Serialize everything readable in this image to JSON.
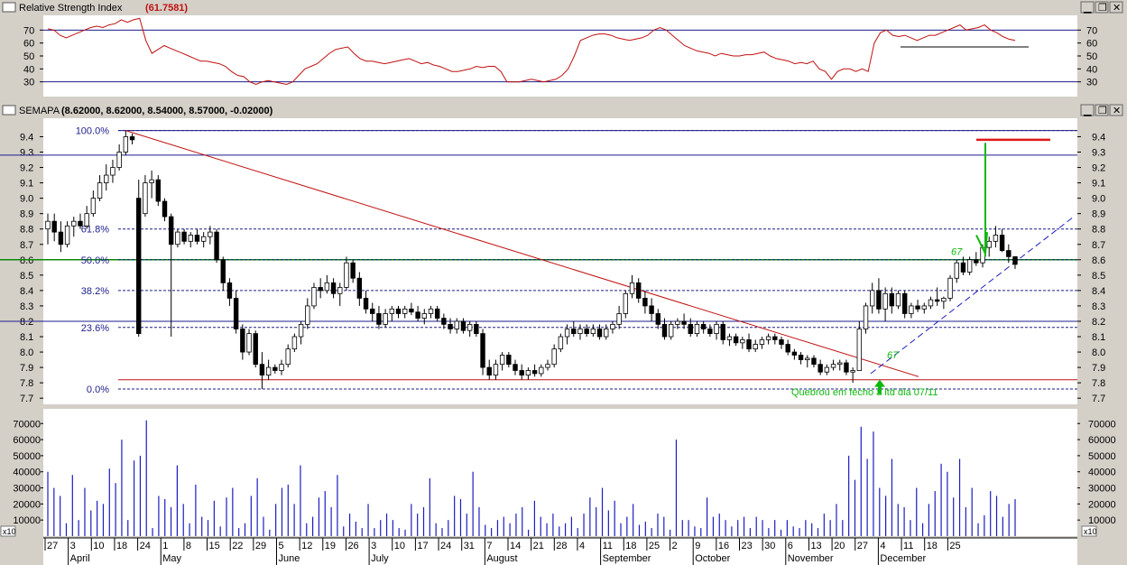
{
  "rsi_panel": {
    "title": "Relative Strength Index",
    "value": "(61.7581)",
    "ticks": [
      70,
      60,
      50,
      40,
      30
    ],
    "levels": [
      70,
      30
    ],
    "ylim": [
      20,
      80
    ],
    "values": [
      71,
      70,
      66,
      64,
      66,
      68,
      70,
      72,
      73,
      72,
      74,
      75,
      78,
      76,
      78,
      79,
      62,
      52,
      55,
      58,
      56,
      54,
      52,
      50,
      48,
      46,
      46,
      45,
      44,
      42,
      38,
      35,
      34,
      30,
      28,
      30,
      31,
      30,
      29,
      28,
      30,
      35,
      40,
      42,
      44,
      48,
      52,
      55,
      56,
      57,
      52,
      48,
      46,
      46,
      45,
      44,
      45,
      46,
      47,
      48,
      46,
      44,
      45,
      43,
      42,
      40,
      38,
      38,
      39,
      40,
      42,
      41,
      42,
      42,
      38,
      30,
      30,
      30,
      31,
      32,
      31,
      30,
      31,
      32,
      35,
      40,
      50,
      62,
      64,
      66,
      67,
      67,
      66,
      64,
      63,
      62,
      63,
      64,
      66,
      70,
      72,
      70,
      66,
      62,
      58,
      56,
      54,
      53,
      52,
      50,
      52,
      51,
      50,
      50,
      51,
      51,
      52,
      53,
      50,
      48,
      47,
      46,
      44,
      45,
      44,
      46,
      40,
      38,
      32,
      38,
      40,
      40,
      38,
      40,
      38,
      60,
      68,
      70,
      66,
      65,
      66,
      64,
      62,
      64,
      66,
      66,
      68,
      70,
      72,
      74,
      70,
      71,
      72,
      74,
      70,
      68,
      65,
      63,
      62
    ],
    "marker_lines": [
      {
        "y": 57
      }
    ]
  },
  "price_panel": {
    "title": "SEMAPA",
    "ohlc": "(8.62000, 8.62000, 8.54000, 8.57000, -0.02000)",
    "ticks": [
      "9.4",
      "9.3",
      "9.2",
      "9.1",
      "9.0",
      "8.9",
      "8.8",
      "8.7",
      "8.6",
      "8.5",
      "8.4",
      "8.3",
      "8.2",
      "8.1",
      "8.0",
      "7.9",
      "7.8",
      "7.7"
    ],
    "ylim": [
      7.66,
      9.52
    ],
    "fib_levels": [
      {
        "label": "100.0%",
        "y": 9.44
      },
      {
        "label": "61.8%",
        "y": 8.8
      },
      {
        "label": "50.0%",
        "y": 8.6
      },
      {
        "label": "38.2%",
        "y": 8.4
      },
      {
        "label": "23.6%",
        "y": 8.16
      },
      {
        "label": "0.0%",
        "y": 7.76
      }
    ],
    "horizontal_lines": [
      {
        "y": 9.44,
        "color": "#1c1c8c"
      },
      {
        "y": 9.28,
        "color": "#1c1c8c"
      },
      {
        "y": 8.6,
        "color": "#0b8a0b"
      },
      {
        "y": 8.2,
        "color": "#1c1c8c"
      },
      {
        "y": 7.82,
        "color": "#c01010"
      }
    ],
    "annotation": "Quebrou em fecho a ltd dia 07/11",
    "ab_label": "67",
    "candles": [
      [
        8.8,
        8.9,
        8.7,
        8.85
      ],
      [
        8.85,
        8.9,
        8.72,
        8.78
      ],
      [
        8.78,
        8.85,
        8.65,
        8.7
      ],
      [
        8.7,
        8.85,
        8.68,
        8.82
      ],
      [
        8.82,
        8.88,
        8.75,
        8.85
      ],
      [
        8.85,
        8.9,
        8.8,
        8.82
      ],
      [
        8.82,
        8.95,
        8.8,
        8.9
      ],
      [
        8.9,
        9.05,
        8.88,
        9.0
      ],
      [
        9.0,
        9.15,
        8.98,
        9.1
      ],
      [
        9.1,
        9.22,
        9.05,
        9.15
      ],
      [
        9.15,
        9.25,
        9.1,
        9.2
      ],
      [
        9.2,
        9.35,
        9.18,
        9.3
      ],
      [
        9.3,
        9.44,
        9.28,
        9.4
      ],
      [
        9.4,
        9.42,
        9.35,
        9.38
      ],
      [
        9.0,
        9.12,
        8.1,
        8.12
      ],
      [
        8.9,
        9.15,
        8.88,
        9.1
      ],
      [
        9.1,
        9.18,
        9.0,
        9.12
      ],
      [
        9.12,
        9.15,
        8.95,
        8.98
      ],
      [
        8.98,
        9.0,
        8.85,
        8.88
      ],
      [
        8.88,
        8.9,
        8.1,
        8.7
      ],
      [
        8.7,
        8.8,
        8.68,
        8.78
      ],
      [
        8.78,
        8.8,
        8.7,
        8.72
      ],
      [
        8.72,
        8.78,
        8.68,
        8.76
      ],
      [
        8.76,
        8.8,
        8.7,
        8.72
      ],
      [
        8.72,
        8.78,
        8.68,
        8.75
      ],
      [
        8.75,
        8.82,
        8.7,
        8.78
      ],
      [
        8.78,
        8.8,
        8.58,
        8.6
      ],
      [
        8.6,
        8.62,
        8.4,
        8.45
      ],
      [
        8.45,
        8.48,
        8.3,
        8.35
      ],
      [
        8.35,
        8.4,
        8.12,
        8.15
      ],
      [
        8.15,
        8.18,
        7.95,
        8.0
      ],
      [
        8.0,
        8.15,
        7.98,
        8.12
      ],
      [
        8.12,
        8.14,
        7.9,
        7.92
      ],
      [
        7.92,
        8.0,
        7.76,
        7.85
      ],
      [
        7.85,
        7.95,
        7.82,
        7.9
      ],
      [
        7.9,
        7.92,
        7.86,
        7.88
      ],
      [
        7.88,
        7.95,
        7.85,
        7.92
      ],
      [
        7.92,
        8.05,
        7.9,
        8.02
      ],
      [
        8.02,
        8.12,
        8.0,
        8.1
      ],
      [
        8.1,
        8.2,
        8.05,
        8.18
      ],
      [
        8.18,
        8.35,
        8.15,
        8.3
      ],
      [
        8.3,
        8.45,
        8.28,
        8.42
      ],
      [
        8.42,
        8.48,
        8.35,
        8.4
      ],
      [
        8.4,
        8.5,
        8.38,
        8.45
      ],
      [
        8.45,
        8.48,
        8.35,
        8.38
      ],
      [
        8.38,
        8.45,
        8.3,
        8.42
      ],
      [
        8.42,
        8.62,
        8.4,
        8.58
      ],
      [
        8.58,
        8.6,
        8.45,
        8.48
      ],
      [
        8.48,
        8.52,
        8.3,
        8.35
      ],
      [
        8.35,
        8.4,
        8.25,
        8.28
      ],
      [
        8.28,
        8.32,
        8.2,
        8.25
      ],
      [
        8.25,
        8.3,
        8.15,
        8.18
      ],
      [
        8.18,
        8.28,
        8.16,
        8.25
      ],
      [
        8.25,
        8.3,
        8.2,
        8.28
      ],
      [
        8.28,
        8.3,
        8.22,
        8.25
      ],
      [
        8.25,
        8.3,
        8.22,
        8.28
      ],
      [
        8.28,
        8.32,
        8.24,
        8.26
      ],
      [
        8.26,
        8.3,
        8.2,
        8.22
      ],
      [
        8.22,
        8.28,
        8.18,
        8.25
      ],
      [
        8.25,
        8.3,
        8.22,
        8.28
      ],
      [
        8.28,
        8.3,
        8.2,
        8.22
      ],
      [
        8.22,
        8.25,
        8.15,
        8.18
      ],
      [
        8.18,
        8.22,
        8.12,
        8.15
      ],
      [
        8.15,
        8.22,
        8.12,
        8.2
      ],
      [
        8.2,
        8.22,
        8.12,
        8.14
      ],
      [
        8.14,
        8.2,
        8.1,
        8.18
      ],
      [
        8.18,
        8.2,
        8.1,
        8.12
      ],
      [
        8.12,
        8.15,
        7.85,
        7.9
      ],
      [
        7.9,
        7.95,
        7.82,
        7.85
      ],
      [
        7.85,
        7.95,
        7.82,
        7.92
      ],
      [
        7.92,
        8.0,
        7.88,
        7.98
      ],
      [
        7.98,
        8.0,
        7.9,
        7.92
      ],
      [
        7.92,
        7.95,
        7.85,
        7.88
      ],
      [
        7.88,
        7.92,
        7.82,
        7.85
      ],
      [
        7.85,
        7.9,
        7.82,
        7.88
      ],
      [
        7.88,
        7.92,
        7.84,
        7.86
      ],
      [
        7.86,
        7.92,
        7.84,
        7.9
      ],
      [
        7.9,
        7.95,
        7.88,
        7.92
      ],
      [
        7.92,
        8.05,
        7.9,
        8.02
      ],
      [
        8.02,
        8.12,
        8.0,
        8.1
      ],
      [
        8.1,
        8.18,
        8.05,
        8.15
      ],
      [
        8.15,
        8.2,
        8.1,
        8.12
      ],
      [
        8.12,
        8.18,
        8.08,
        8.15
      ],
      [
        8.15,
        8.18,
        8.1,
        8.12
      ],
      [
        8.12,
        8.18,
        8.1,
        8.15
      ],
      [
        8.15,
        8.18,
        8.08,
        8.1
      ],
      [
        8.1,
        8.18,
        8.08,
        8.15
      ],
      [
        8.15,
        8.2,
        8.12,
        8.18
      ],
      [
        8.18,
        8.3,
        8.15,
        8.25
      ],
      [
        8.25,
        8.4,
        8.22,
        8.38
      ],
      [
        8.38,
        8.5,
        8.35,
        8.45
      ],
      [
        8.45,
        8.48,
        8.32,
        8.35
      ],
      [
        8.35,
        8.4,
        8.25,
        8.3
      ],
      [
        8.3,
        8.35,
        8.2,
        8.25
      ],
      [
        8.25,
        8.28,
        8.15,
        8.18
      ],
      [
        8.18,
        8.22,
        8.08,
        8.1
      ],
      [
        8.1,
        8.2,
        8.08,
        8.18
      ],
      [
        8.18,
        8.22,
        8.15,
        8.2
      ],
      [
        8.2,
        8.25,
        8.15,
        8.18
      ],
      [
        8.18,
        8.22,
        8.1,
        8.12
      ],
      [
        8.12,
        8.2,
        8.1,
        8.18
      ],
      [
        8.18,
        8.2,
        8.12,
        8.15
      ],
      [
        8.15,
        8.18,
        8.1,
        8.12
      ],
      [
        8.12,
        8.2,
        8.08,
        8.18
      ],
      [
        8.18,
        8.2,
        8.05,
        8.08
      ],
      [
        8.08,
        8.12,
        8.04,
        8.1
      ],
      [
        8.1,
        8.12,
        8.04,
        8.06
      ],
      [
        8.06,
        8.1,
        8.02,
        8.08
      ],
      [
        8.08,
        8.12,
        8.0,
        8.02
      ],
      [
        8.02,
        8.08,
        8.0,
        8.05
      ],
      [
        8.05,
        8.1,
        8.02,
        8.08
      ],
      [
        8.08,
        8.12,
        8.05,
        8.1
      ],
      [
        8.1,
        8.12,
        8.05,
        8.08
      ],
      [
        8.08,
        8.1,
        8.02,
        8.05
      ],
      [
        8.05,
        8.08,
        7.98,
        8.0
      ],
      [
        8.0,
        8.02,
        7.95,
        7.98
      ],
      [
        7.98,
        8.0,
        7.92,
        7.95
      ],
      [
        7.95,
        7.98,
        7.9,
        7.96
      ],
      [
        7.96,
        7.98,
        7.9,
        7.92
      ],
      [
        7.92,
        7.95,
        7.85,
        7.87
      ],
      [
        7.87,
        7.92,
        7.85,
        7.9
      ],
      [
        7.9,
        7.95,
        7.88,
        7.92
      ],
      [
        7.92,
        7.95,
        7.88,
        7.93
      ],
      [
        7.93,
        7.95,
        7.85,
        7.87
      ],
      [
        7.87,
        7.9,
        7.8,
        7.88
      ],
      [
        7.88,
        8.2,
        7.88,
        8.15
      ],
      [
        8.15,
        8.32,
        8.12,
        8.3
      ],
      [
        8.3,
        8.45,
        8.25,
        8.4
      ],
      [
        8.4,
        8.48,
        8.25,
        8.28
      ],
      [
        8.28,
        8.42,
        8.2,
        8.38
      ],
      [
        8.38,
        8.42,
        8.25,
        8.3
      ],
      [
        8.3,
        8.4,
        8.28,
        8.38
      ],
      [
        8.38,
        8.4,
        8.22,
        8.25
      ],
      [
        8.25,
        8.32,
        8.22,
        8.3
      ],
      [
        8.3,
        8.34,
        8.26,
        8.28
      ],
      [
        8.28,
        8.32,
        8.25,
        8.3
      ],
      [
        8.3,
        8.36,
        8.28,
        8.34
      ],
      [
        8.34,
        8.42,
        8.3,
        8.33
      ],
      [
        8.33,
        8.36,
        8.28,
        8.35
      ],
      [
        8.35,
        8.5,
        8.33,
        8.48
      ],
      [
        8.48,
        8.6,
        8.45,
        8.58
      ],
      [
        8.58,
        8.62,
        8.5,
        8.52
      ],
      [
        8.52,
        8.62,
        8.5,
        8.6
      ],
      [
        8.6,
        8.65,
        8.56,
        8.58
      ],
      [
        8.58,
        8.7,
        8.55,
        8.68
      ],
      [
        8.68,
        8.75,
        8.62,
        8.72
      ],
      [
        8.72,
        8.82,
        8.68,
        8.76
      ],
      [
        8.76,
        8.8,
        8.65,
        8.66
      ],
      [
        8.66,
        8.7,
        8.58,
        8.62
      ],
      [
        8.62,
        8.62,
        8.54,
        8.57
      ]
    ]
  },
  "volume_panel": {
    "multiplier": "x10",
    "ticks": [
      "70000",
      "60000",
      "50000",
      "40000",
      "30000",
      "20000",
      "10000"
    ],
    "ylim": [
      0,
      78000
    ],
    "values": [
      40000,
      30000,
      25000,
      8000,
      38000,
      10000,
      30000,
      16000,
      22000,
      20000,
      42000,
      33000,
      60000,
      10000,
      47000,
      50000,
      72000,
      5000,
      25000,
      23000,
      18000,
      44000,
      20000,
      8000,
      32000,
      12000,
      10000,
      22000,
      6000,
      24000,
      30000,
      5000,
      8000,
      25000,
      36000,
      12000,
      4000,
      20000,
      30000,
      32000,
      20000,
      44000,
      8000,
      12000,
      24000,
      28000,
      18000,
      38000,
      6000,
      14000,
      9000,
      5000,
      20000,
      5000,
      10000,
      14000,
      10000,
      5000,
      4000,
      20000,
      14000,
      18000,
      36000,
      8000,
      5000,
      10000,
      25000,
      23000,
      14000,
      40000,
      18000,
      7000,
      5000,
      10000,
      12000,
      8000,
      14000,
      18000,
      4000,
      22000,
      12000,
      8000,
      14000,
      6000,
      8000,
      12000,
      5000,
      14000,
      24000,
      18000,
      30000,
      16000,
      22000,
      8000,
      12000,
      20000,
      7000,
      9000,
      5000,
      14000,
      12000,
      4000,
      60000,
      10000,
      10000,
      6000,
      5000,
      24000,
      12000,
      14000,
      10000,
      6000,
      10000,
      12000,
      5000,
      12000,
      10000,
      5000,
      10000,
      4000,
      10000,
      6000,
      5000,
      10000,
      8000,
      5000,
      14000,
      10000,
      20000,
      10000,
      50000,
      35000,
      68000,
      48000,
      65000,
      30000,
      25000,
      48000,
      20000,
      18000,
      10000,
      30000,
      8000,
      20000,
      28000,
      45000,
      40000,
      24000,
      48000,
      18000,
      30000,
      8000,
      13000,
      28000,
      25000,
      12000,
      20000,
      23000
    ]
  },
  "x_axis": {
    "day_labels": [
      "27",
      "3",
      "10",
      "18",
      "24",
      "1",
      "8",
      "15",
      "22",
      "29",
      "5",
      "12",
      "19",
      "26",
      "3",
      "10",
      "17",
      "24",
      "31",
      "7",
      "14",
      "21",
      "28",
      "4",
      "11",
      "18",
      "25",
      "2",
      "9",
      "16",
      "23",
      "30",
      "6",
      "13",
      "20",
      "27",
      "4",
      "11",
      "18",
      "25"
    ],
    "month_labels": [
      "April",
      "May",
      "June",
      "July",
      "August",
      "September",
      "October",
      "November",
      "December"
    ]
  },
  "colors": {
    "rsi": "#c01010",
    "price_trend": "#c01010",
    "fib": "#1c1c8c",
    "support": "#0b8a0b",
    "annotation": "#0db80d",
    "target": "#e01818",
    "volume": "#1c1cc0",
    "uptrend": "#1c1cc0"
  }
}
